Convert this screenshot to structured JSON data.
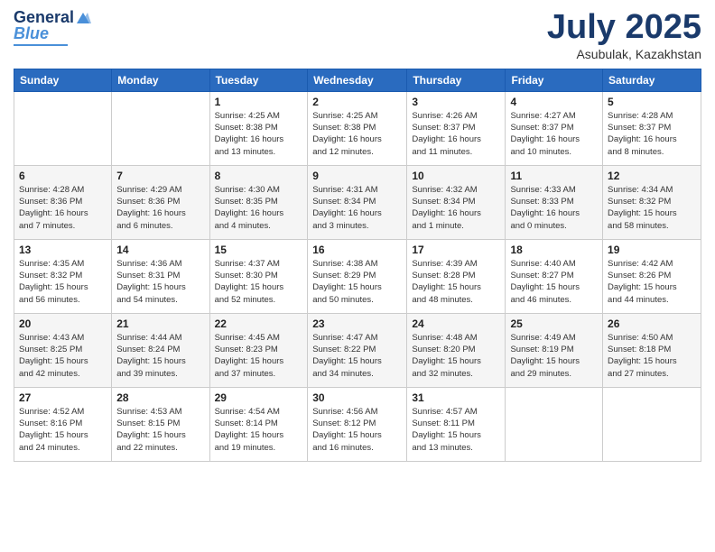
{
  "logo": {
    "line1": "General",
    "line2": "Blue"
  },
  "header": {
    "month": "July 2025",
    "location": "Asubulak, Kazakhstan"
  },
  "weekdays": [
    "Sunday",
    "Monday",
    "Tuesday",
    "Wednesday",
    "Thursday",
    "Friday",
    "Saturday"
  ],
  "weeks": [
    [
      {
        "day": "",
        "info": ""
      },
      {
        "day": "",
        "info": ""
      },
      {
        "day": "1",
        "info": "Sunrise: 4:25 AM\nSunset: 8:38 PM\nDaylight: 16 hours\nand 13 minutes."
      },
      {
        "day": "2",
        "info": "Sunrise: 4:25 AM\nSunset: 8:38 PM\nDaylight: 16 hours\nand 12 minutes."
      },
      {
        "day": "3",
        "info": "Sunrise: 4:26 AM\nSunset: 8:37 PM\nDaylight: 16 hours\nand 11 minutes."
      },
      {
        "day": "4",
        "info": "Sunrise: 4:27 AM\nSunset: 8:37 PM\nDaylight: 16 hours\nand 10 minutes."
      },
      {
        "day": "5",
        "info": "Sunrise: 4:28 AM\nSunset: 8:37 PM\nDaylight: 16 hours\nand 8 minutes."
      }
    ],
    [
      {
        "day": "6",
        "info": "Sunrise: 4:28 AM\nSunset: 8:36 PM\nDaylight: 16 hours\nand 7 minutes."
      },
      {
        "day": "7",
        "info": "Sunrise: 4:29 AM\nSunset: 8:36 PM\nDaylight: 16 hours\nand 6 minutes."
      },
      {
        "day": "8",
        "info": "Sunrise: 4:30 AM\nSunset: 8:35 PM\nDaylight: 16 hours\nand 4 minutes."
      },
      {
        "day": "9",
        "info": "Sunrise: 4:31 AM\nSunset: 8:34 PM\nDaylight: 16 hours\nand 3 minutes."
      },
      {
        "day": "10",
        "info": "Sunrise: 4:32 AM\nSunset: 8:34 PM\nDaylight: 16 hours\nand 1 minute."
      },
      {
        "day": "11",
        "info": "Sunrise: 4:33 AM\nSunset: 8:33 PM\nDaylight: 16 hours\nand 0 minutes."
      },
      {
        "day": "12",
        "info": "Sunrise: 4:34 AM\nSunset: 8:32 PM\nDaylight: 15 hours\nand 58 minutes."
      }
    ],
    [
      {
        "day": "13",
        "info": "Sunrise: 4:35 AM\nSunset: 8:32 PM\nDaylight: 15 hours\nand 56 minutes."
      },
      {
        "day": "14",
        "info": "Sunrise: 4:36 AM\nSunset: 8:31 PM\nDaylight: 15 hours\nand 54 minutes."
      },
      {
        "day": "15",
        "info": "Sunrise: 4:37 AM\nSunset: 8:30 PM\nDaylight: 15 hours\nand 52 minutes."
      },
      {
        "day": "16",
        "info": "Sunrise: 4:38 AM\nSunset: 8:29 PM\nDaylight: 15 hours\nand 50 minutes."
      },
      {
        "day": "17",
        "info": "Sunrise: 4:39 AM\nSunset: 8:28 PM\nDaylight: 15 hours\nand 48 minutes."
      },
      {
        "day": "18",
        "info": "Sunrise: 4:40 AM\nSunset: 8:27 PM\nDaylight: 15 hours\nand 46 minutes."
      },
      {
        "day": "19",
        "info": "Sunrise: 4:42 AM\nSunset: 8:26 PM\nDaylight: 15 hours\nand 44 minutes."
      }
    ],
    [
      {
        "day": "20",
        "info": "Sunrise: 4:43 AM\nSunset: 8:25 PM\nDaylight: 15 hours\nand 42 minutes."
      },
      {
        "day": "21",
        "info": "Sunrise: 4:44 AM\nSunset: 8:24 PM\nDaylight: 15 hours\nand 39 minutes."
      },
      {
        "day": "22",
        "info": "Sunrise: 4:45 AM\nSunset: 8:23 PM\nDaylight: 15 hours\nand 37 minutes."
      },
      {
        "day": "23",
        "info": "Sunrise: 4:47 AM\nSunset: 8:22 PM\nDaylight: 15 hours\nand 34 minutes."
      },
      {
        "day": "24",
        "info": "Sunrise: 4:48 AM\nSunset: 8:20 PM\nDaylight: 15 hours\nand 32 minutes."
      },
      {
        "day": "25",
        "info": "Sunrise: 4:49 AM\nSunset: 8:19 PM\nDaylight: 15 hours\nand 29 minutes."
      },
      {
        "day": "26",
        "info": "Sunrise: 4:50 AM\nSunset: 8:18 PM\nDaylight: 15 hours\nand 27 minutes."
      }
    ],
    [
      {
        "day": "27",
        "info": "Sunrise: 4:52 AM\nSunset: 8:16 PM\nDaylight: 15 hours\nand 24 minutes."
      },
      {
        "day": "28",
        "info": "Sunrise: 4:53 AM\nSunset: 8:15 PM\nDaylight: 15 hours\nand 22 minutes."
      },
      {
        "day": "29",
        "info": "Sunrise: 4:54 AM\nSunset: 8:14 PM\nDaylight: 15 hours\nand 19 minutes."
      },
      {
        "day": "30",
        "info": "Sunrise: 4:56 AM\nSunset: 8:12 PM\nDaylight: 15 hours\nand 16 minutes."
      },
      {
        "day": "31",
        "info": "Sunrise: 4:57 AM\nSunset: 8:11 PM\nDaylight: 15 hours\nand 13 minutes."
      },
      {
        "day": "",
        "info": ""
      },
      {
        "day": "",
        "info": ""
      }
    ]
  ]
}
